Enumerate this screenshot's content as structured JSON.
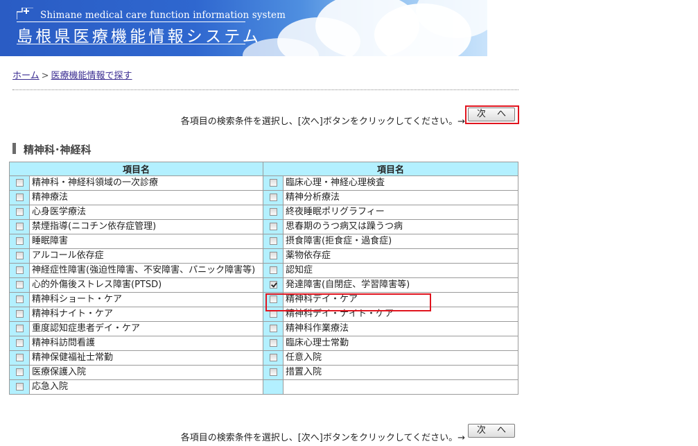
{
  "header": {
    "title_en": "Shimane medical care function information system",
    "title_jp": "島根県医療機能情報システム"
  },
  "breadcrumb": {
    "home": "ホーム",
    "separator": ">",
    "current": "医療機能情報で探す"
  },
  "instruction": {
    "text": "各項目の検索条件を選択し、[次へ]ボタンをクリックしてください。→",
    "next_label": "次 へ"
  },
  "section": {
    "title": "精神科･神経科"
  },
  "table": {
    "header_left": "項目名",
    "header_right": "項目名",
    "left_items": [
      {
        "label": "精神科・神経科領域の一次診療",
        "checked": false
      },
      {
        "label": "精神療法",
        "checked": false
      },
      {
        "label": "心身医学療法",
        "checked": false
      },
      {
        "label": "禁煙指導(ニコチン依存症管理)",
        "checked": false
      },
      {
        "label": "睡眠障害",
        "checked": false
      },
      {
        "label": "アルコール依存症",
        "checked": false
      },
      {
        "label": "神経症性障害(強迫性障害、不安障害、パニック障害等)",
        "checked": false
      },
      {
        "label": "心的外傷後ストレス障害(PTSD)",
        "checked": false
      },
      {
        "label": "精神科ショート・ケア",
        "checked": false
      },
      {
        "label": "精神科ナイト・ケア",
        "checked": false
      },
      {
        "label": "重度認知症患者デイ・ケア",
        "checked": false
      },
      {
        "label": "精神科訪問看護",
        "checked": false
      },
      {
        "label": "精神保健福祉士常勤",
        "checked": false
      },
      {
        "label": "医療保護入院",
        "checked": false
      },
      {
        "label": "応急入院",
        "checked": false
      }
    ],
    "right_items": [
      {
        "label": "臨床心理・神経心理検査",
        "checked": false
      },
      {
        "label": "精神分析療法",
        "checked": false
      },
      {
        "label": "終夜睡眠ポリグラフィー",
        "checked": false
      },
      {
        "label": "思春期のうつ病又は躁うつ病",
        "checked": false
      },
      {
        "label": "摂食障害(拒食症・過食症)",
        "checked": false
      },
      {
        "label": "薬物依存症",
        "checked": false
      },
      {
        "label": "認知症",
        "checked": false
      },
      {
        "label": "発達障害(自閉症、学習障害等)",
        "checked": true
      },
      {
        "label": "精神科デイ・ケア",
        "checked": false
      },
      {
        "label": "精神科デイ・ナイト・ケア",
        "checked": false
      },
      {
        "label": "精神科作業療法",
        "checked": false
      },
      {
        "label": "臨床心理士常勤",
        "checked": false
      },
      {
        "label": "任意入院",
        "checked": false
      },
      {
        "label": "措置入院",
        "checked": false
      }
    ]
  },
  "colors": {
    "header_cell": "#b3f0ff",
    "highlight": "#e0141e",
    "link": "#3a2c91"
  }
}
